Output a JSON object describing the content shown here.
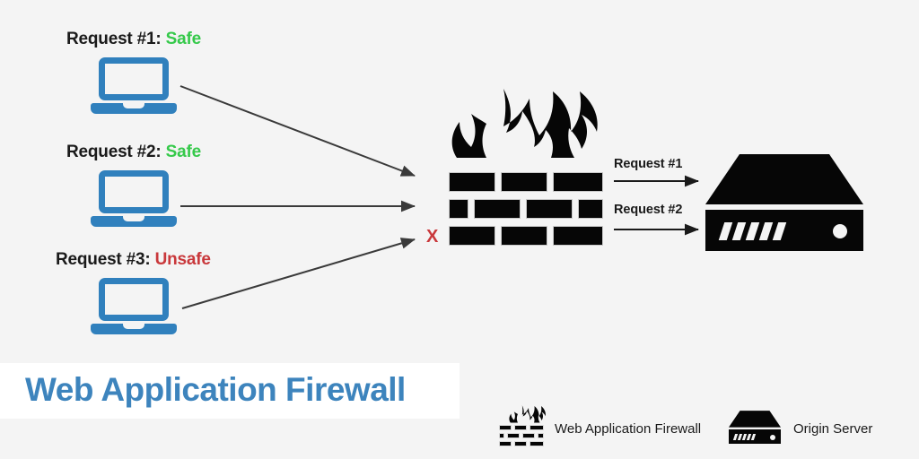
{
  "diagram": {
    "title": "Web Application Firewall",
    "background_color": "#f4f4f4",
    "accent_color": "#3d84bd",
    "safe_color": "#35c94a",
    "unsafe_color": "#c9383b"
  },
  "clients": [
    {
      "label_prefix": "Request #1:",
      "verdict": "Safe",
      "verdict_state": "safe",
      "icon": "laptop-icon"
    },
    {
      "label_prefix": "Request #2:",
      "verdict": "Safe",
      "verdict_state": "safe",
      "icon": "laptop-icon"
    },
    {
      "label_prefix": "Request #3:",
      "verdict": "Unsafe",
      "verdict_state": "unsafe",
      "icon": "laptop-icon"
    }
  ],
  "firewall": {
    "icon": "firewall-icon",
    "blocked_marker": "X"
  },
  "forwarded": [
    {
      "label": "Request #1"
    },
    {
      "label": "Request #2"
    }
  ],
  "server": {
    "icon": "server-icon"
  },
  "legend": [
    {
      "icon": "firewall-icon",
      "label": "Web Application Firewall"
    },
    {
      "icon": "server-icon",
      "label": "Origin Server"
    }
  ]
}
